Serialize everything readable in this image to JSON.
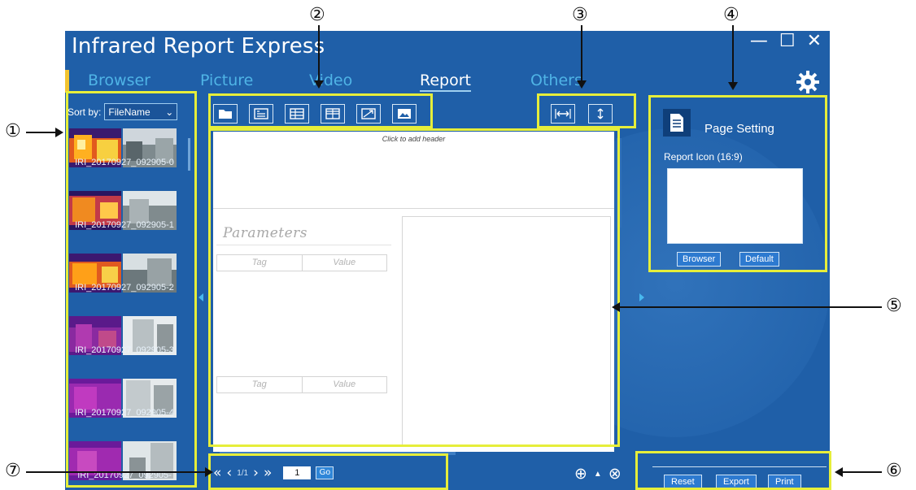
{
  "window": {
    "title": "Infrared Report Express",
    "minimize": "—",
    "maximize": "☐",
    "close": "✕"
  },
  "nav": {
    "tabs": [
      {
        "label": "Browser"
      },
      {
        "label": "Picture"
      },
      {
        "label": "Video"
      },
      {
        "label": "Report"
      },
      {
        "label": "Others"
      }
    ],
    "active": "Report"
  },
  "sidebar": {
    "sort_label": "Sort by:",
    "sort_value": "FileName",
    "thumbnails": [
      {
        "caption": "IRI_20170927_092905-0",
        "palette": "ironbow"
      },
      {
        "caption": "IRI_20170927_092905-1",
        "palette": "ironbow"
      },
      {
        "caption": "IRI_20170927_092905-2",
        "palette": "ironbow"
      },
      {
        "caption": "IRI_20170927_092905-3",
        "palette": "purple"
      },
      {
        "caption": "IRI_20170927_092905-4",
        "palette": "purple"
      },
      {
        "caption": "IRI_20170927_092905-",
        "palette": "purple"
      }
    ]
  },
  "toolbar": {
    "tools": [
      "open-folder-icon",
      "text-box-icon",
      "table-icon",
      "grid-icon",
      "chart-icon",
      "image-icon"
    ],
    "fit_tools": [
      "fit-width-icon",
      "fit-height-icon"
    ]
  },
  "report": {
    "header_hint": "Click to add header",
    "params_title": "Parameters",
    "table1": {
      "tag": "Tag",
      "value": "Value"
    },
    "table2": {
      "tag": "Tag",
      "value": "Value"
    }
  },
  "page_setting": {
    "title": "Page Setting",
    "icon_label": "Report Icon (16:9)",
    "browser_button": "Browser",
    "default_button": "Default"
  },
  "pager": {
    "first": "«",
    "prev": "‹",
    "page_info": "1/1",
    "next": "›",
    "last": "»",
    "page_input": "1",
    "go": "Go"
  },
  "zoom": {
    "zoom_in": "⊕",
    "up": "▲",
    "zoom_out": "⊗"
  },
  "actions": {
    "reset": "Reset",
    "export": "Export",
    "print": "Print"
  },
  "callouts": {
    "c1": "①",
    "c2": "②",
    "c3": "③",
    "c4": "④",
    "c5": "⑤",
    "c6": "⑥",
    "c7": "⑦"
  },
  "colors": {
    "app_bg": "#1f5fa8",
    "highlight": "#e6ee3a",
    "tab_inactive": "#4fb4e6",
    "accent": "#f2c430"
  }
}
